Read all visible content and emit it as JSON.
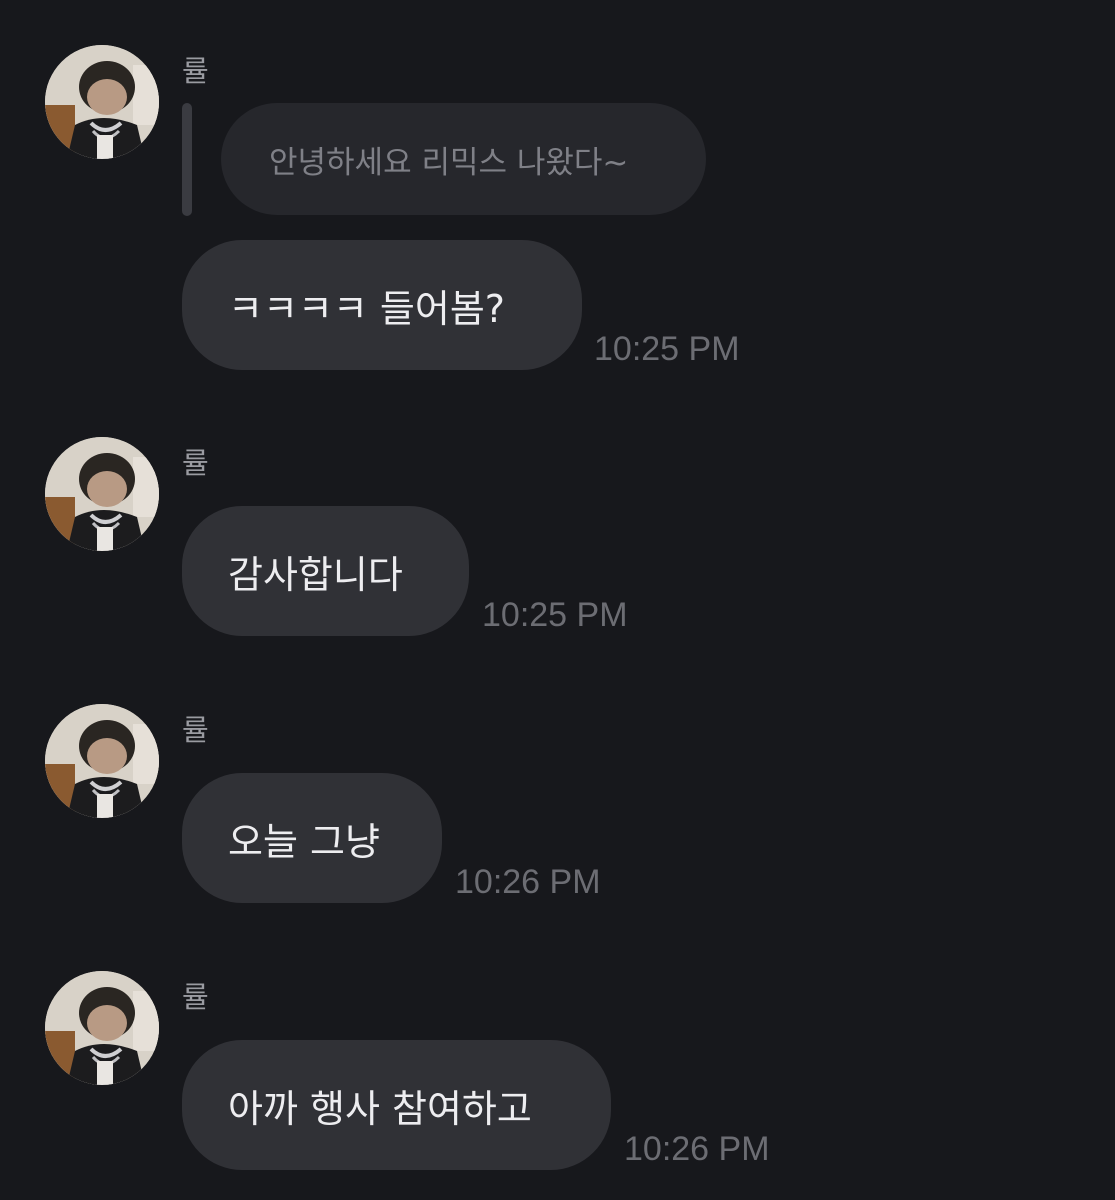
{
  "messages": [
    {
      "sender": "률",
      "avatar_icon": "profile-photo-avatar",
      "quote": "안녕하세요 리믹스 나왔다~",
      "text": "ㅋㅋㅋㅋ 들어봄?",
      "time": "10:25 PM"
    },
    {
      "sender": "률",
      "avatar_icon": "profile-photo-avatar",
      "text": "감사합니다",
      "time": "10:25 PM"
    },
    {
      "sender": "률",
      "avatar_icon": "profile-photo-avatar",
      "text": "오늘 그냥",
      "time": "10:26 PM"
    },
    {
      "sender": "률",
      "avatar_icon": "profile-photo-avatar",
      "text": "아까 행사 참여하고",
      "time": "10:26 PM"
    }
  ],
  "colors": {
    "background": "#17181c",
    "bubble": "#303136",
    "quote_bubble": "#26272c",
    "message_text": "#ededf0",
    "timestamp": "#6c6d73",
    "sender_name": "#9a9ba1"
  }
}
